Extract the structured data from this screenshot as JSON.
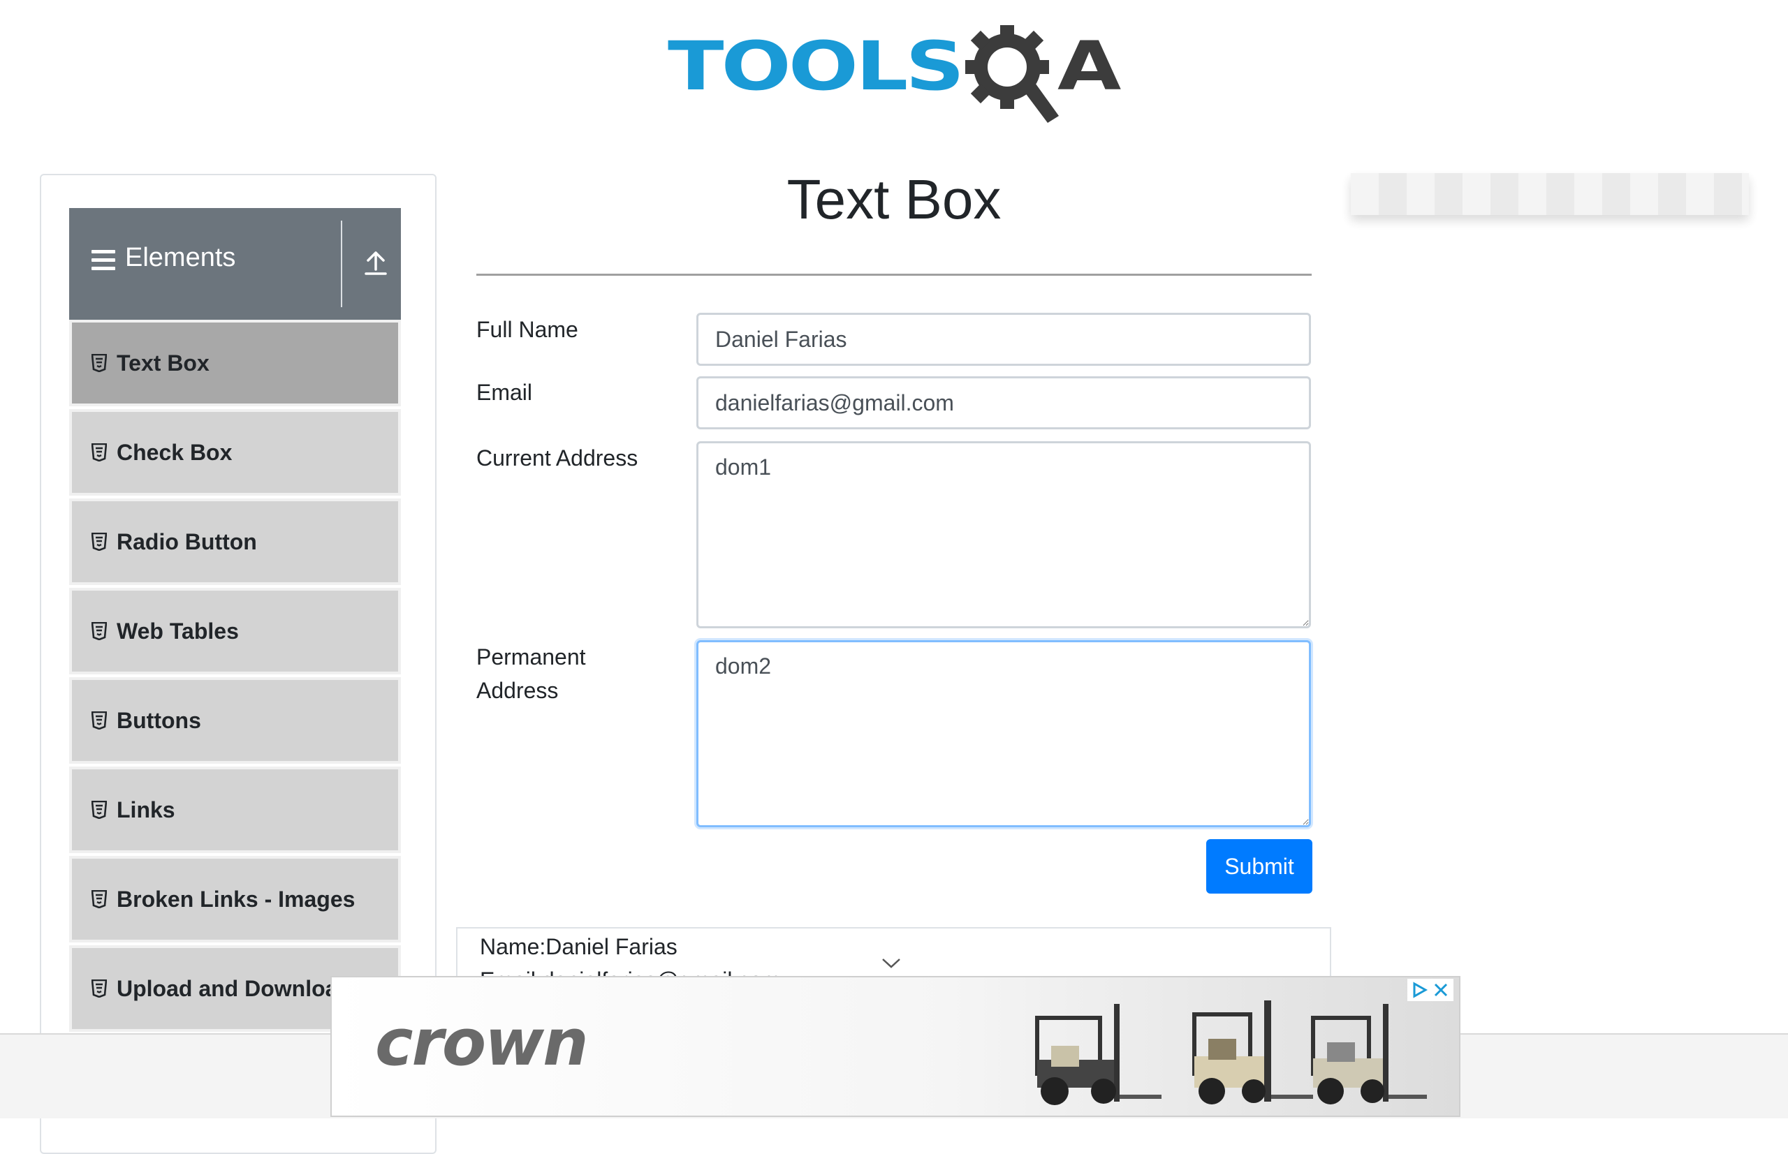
{
  "header": {
    "logo_text_blue": "TOOLS",
    "logo_text_dark": "A",
    "logo_alt": "TOOLSQA"
  },
  "sidebar": {
    "group": {
      "title": "Elements",
      "icon": "hamburger-icon",
      "collapse_icon": "upload-arrow-icon"
    },
    "items": [
      {
        "label": "Text Box",
        "icon": "html5-icon",
        "active": true
      },
      {
        "label": "Check Box",
        "icon": "html5-icon",
        "active": false
      },
      {
        "label": "Radio Button",
        "icon": "html5-icon",
        "active": false
      },
      {
        "label": "Web Tables",
        "icon": "html5-icon",
        "active": false
      },
      {
        "label": "Buttons",
        "icon": "html5-icon",
        "active": false
      },
      {
        "label": "Links",
        "icon": "html5-icon",
        "active": false
      },
      {
        "label": "Broken Links - Images",
        "icon": "html5-icon",
        "active": false
      },
      {
        "label": "Upload and Download",
        "icon": "html5-icon",
        "active": false
      }
    ]
  },
  "main": {
    "title": "Text Box",
    "form": {
      "full_name": {
        "label": "Full Name",
        "value": "Daniel Farias"
      },
      "email": {
        "label": "Email",
        "value": "danielfarias@gmail.com"
      },
      "current_address": {
        "label": "Current Address",
        "value": "dom1"
      },
      "permanent_address": {
        "label_line1": "Permanent",
        "label_line2": "Address",
        "value": "dom2"
      },
      "submit_label": "Submit"
    },
    "output": {
      "name_line": "Name:Daniel Farias",
      "email_line": "Email:danielfarias@gmail.com"
    }
  },
  "ad": {
    "brand": "crown",
    "controls": [
      "adchoices-icon",
      "close-icon"
    ]
  },
  "colors": {
    "primary": "#007bff",
    "sidebar_header": "#6c757d",
    "menu_item": "#d3d3d3",
    "menu_item_active": "#a8a8a8",
    "logo_blue": "#1a9ad6"
  }
}
